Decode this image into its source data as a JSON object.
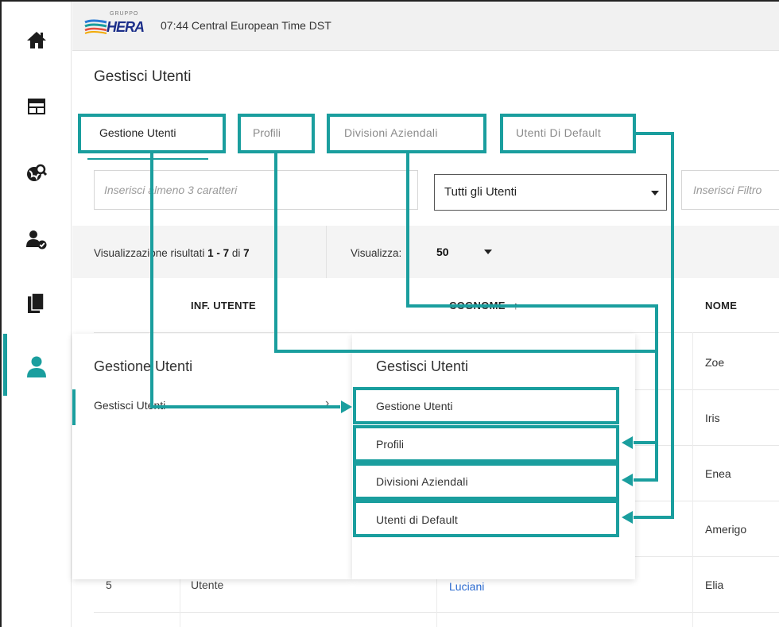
{
  "brand": {
    "logo_text": "HERA",
    "logo_small": "GRUPPO",
    "logo_colors": [
      "#1a9e9e",
      "#2a7ad5",
      "#e44c3e",
      "#f2a900"
    ]
  },
  "clock": "07:44 Central European Time DST",
  "rail": {
    "icons": [
      "home-icon",
      "dashboard-icon",
      "network-search-icon",
      "user-check-icon",
      "documents-icon",
      "user-icon"
    ],
    "active_index": 5
  },
  "page_title": "Gestisci Utenti",
  "tabs": [
    {
      "label": "Gestione Utenti",
      "active": true
    },
    {
      "label": "Profili",
      "active": false
    },
    {
      "label": "Divisioni Aziendali",
      "active": false
    },
    {
      "label": "Utenti Di Default",
      "active": false
    }
  ],
  "filters": {
    "search_placeholder": "Inserisci almeno 3 caratteri",
    "user_type_select": "Tutti gli Utenti",
    "filter2_placeholder": "Inserisci Filtro"
  },
  "results": {
    "prefix": "Visualizzazione risultati",
    "range": "1 - 7",
    "of": "di",
    "total": "7",
    "view_label": "Visualizza:",
    "view_value": "50"
  },
  "table": {
    "headers": {
      "info": "INF. UTENTE",
      "surname": "COGNOME",
      "name": "NOME"
    },
    "names": [
      "Zoe",
      "Iris",
      "Enea",
      "Amerigo",
      "Elia"
    ],
    "last_row": {
      "id": "5",
      "info": "Utente",
      "surname": "Luciani",
      "name": "Elia"
    }
  },
  "menu_left": {
    "title": "Gestione Utenti",
    "item": "Gestisci Utenti",
    "chevron": "›"
  },
  "menu_right": {
    "title": "Gestisci Utenti",
    "items": [
      "Gestione Utenti",
      "Profili",
      "Divisioni Aziendali",
      "Utenti di Default"
    ]
  },
  "colors": {
    "accent": "#1a9e9e",
    "link": "#2a6ad0"
  }
}
